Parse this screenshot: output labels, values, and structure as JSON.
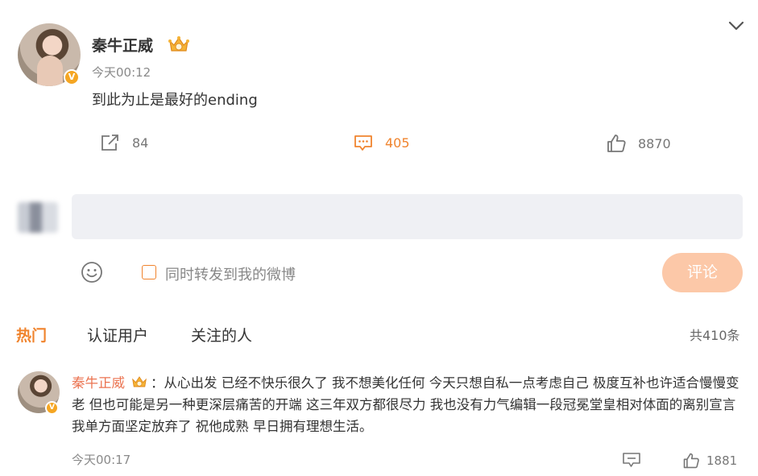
{
  "post": {
    "username": "秦牛正威",
    "time": "今天00:12",
    "text": "到此为止是最好的ending",
    "verified_badge": "V",
    "shares": "84",
    "comments": "405",
    "likes": "8870"
  },
  "compose": {
    "placeholder": "",
    "repost_label": "同时转发到我的微博",
    "submit_label": "评论"
  },
  "tabs": {
    "hot": "热门",
    "verified": "认证用户",
    "following": "关注的人",
    "total": "共410条"
  },
  "comment": {
    "username": "秦牛正威",
    "separator": "：",
    "text": "从心出发 已经不快乐很久了 我不想美化任何 今天只想自私一点考虑自己 极度互补也许适合慢慢变老 但也可能是另一种更深层痛苦的开端 这三年双方都很尽力 我也没有力气编辑一段冠冕堂皇相对体面的离别宣言 我单方面坚定放弃了 祝他成熟 早日拥有理想生活。",
    "time": "今天00:17",
    "likes": "1881",
    "verified_badge": "V"
  },
  "colors": {
    "accent": "#f0842e",
    "name": "#eb7350",
    "submit_bg": "#fcc8a8",
    "input_bg": "#eff0f4"
  },
  "icons": {
    "share": "share-icon",
    "comment": "comment-icon",
    "like": "thumbs-up-icon",
    "emoji": "smiley-icon",
    "crown": "crown-badge-icon",
    "collapse": "chevron-down-icon"
  }
}
